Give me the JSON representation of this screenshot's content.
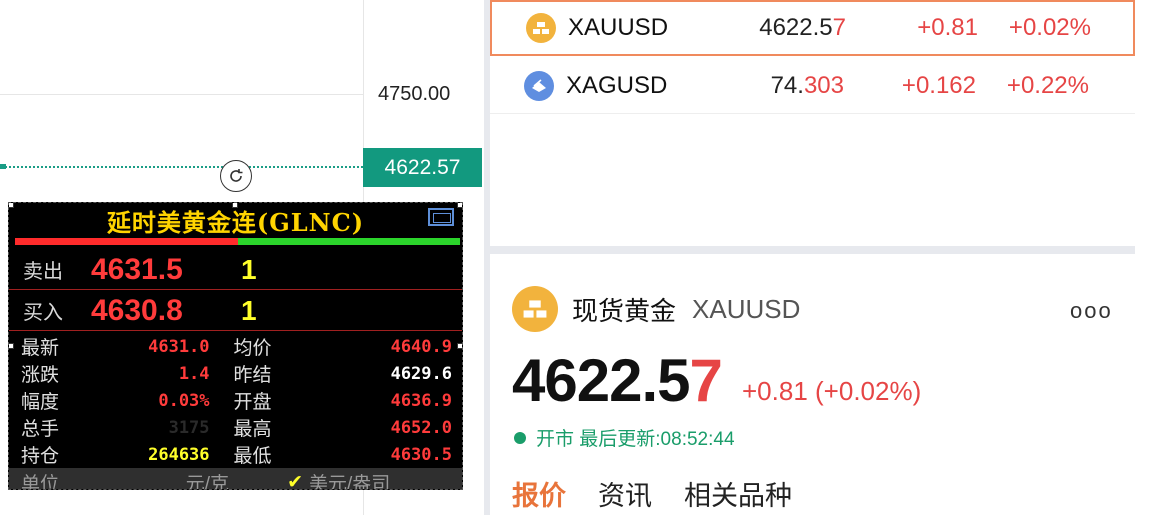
{
  "chart": {
    "axis_label": "4750.00",
    "current_price": "4622.57"
  },
  "widget": {
    "title": "延时美黄金连(GLNC)",
    "sell": {
      "label": "卖出",
      "price": "4631.5",
      "qty": "1"
    },
    "buy": {
      "label": "买入",
      "price": "4630.8",
      "qty": "1"
    },
    "stats": [
      {
        "l1": "最新",
        "v1": "4631.0",
        "l2": "均价",
        "v2": "4640.9",
        "c1": "red",
        "c2": "red"
      },
      {
        "l1": "涨跌",
        "v1": "1.4",
        "l2": "昨结",
        "v2": "4629.6",
        "c1": "red",
        "c2": "white"
      },
      {
        "l1": "幅度",
        "v1": "0.03%",
        "l2": "开盘",
        "v2": "4636.9",
        "c1": "red",
        "c2": "red"
      },
      {
        "l1": "总手",
        "v1": "3175",
        "l2": "最高",
        "v2": "4652.0",
        "c1": "masked",
        "c2": "red"
      },
      {
        "l1": "持仓",
        "v1": "264636",
        "l2": "最低",
        "v2": "4630.5",
        "c1": "yellow",
        "c2": "red"
      }
    ],
    "unit": {
      "label": "单位",
      "opt1": "元/克",
      "check": "✔",
      "opt2": "美元/盎司"
    }
  },
  "watchlist": [
    {
      "symbol": "XAUUSD",
      "price_main": "4622.5",
      "price_hl": "7",
      "change": "+0.81",
      "pct": "+0.02%",
      "icon": "gold-bar-icon"
    },
    {
      "symbol": "XAGUSD",
      "price_main": "74.",
      "price_hl": "303",
      "change": "+0.162",
      "pct": "+0.22%",
      "icon": "silver-bar-icon"
    }
  ],
  "detail": {
    "name": "现货黄金",
    "code": "XAUUSD",
    "more": "ooo",
    "price_main": "4622.5",
    "price_hl": "7",
    "change": "+0.81 (+0.02%)",
    "status": "开市 最后更新:08:52:44",
    "tabs": [
      "报价",
      "资讯",
      "相关品种"
    ]
  },
  "colors": {
    "up": "#e64545",
    "accent": "#12997f",
    "tab_active": "#e8743b",
    "gold": "#f2b33d",
    "silver": "#5f8ee0"
  }
}
